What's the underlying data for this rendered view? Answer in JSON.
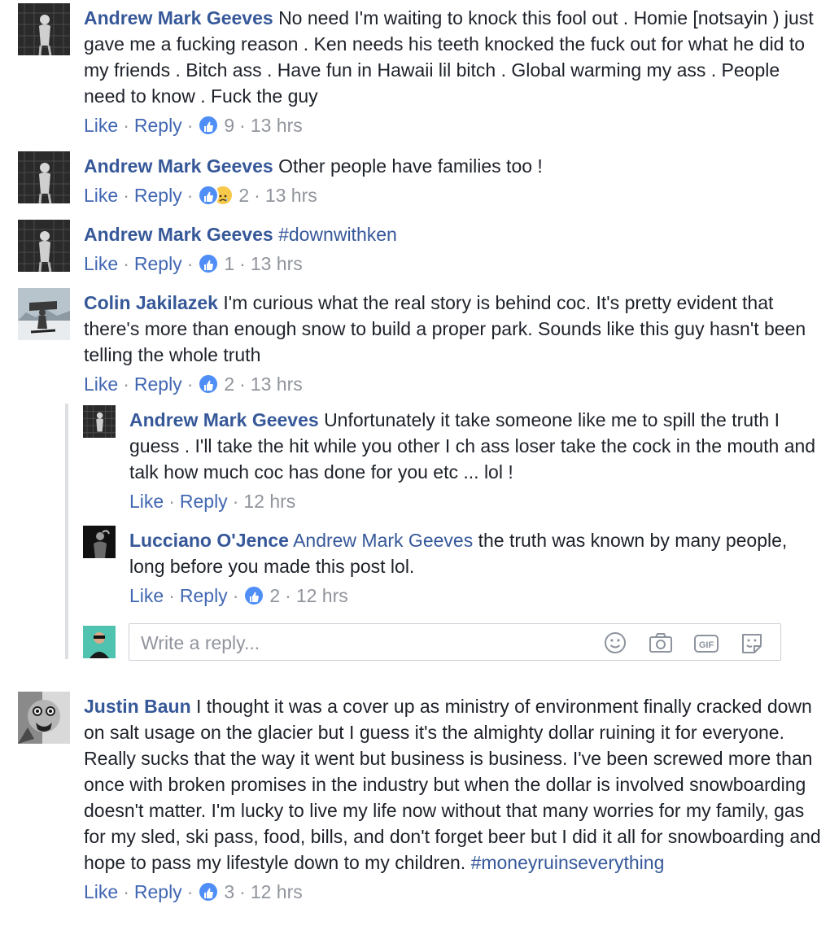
{
  "actions": {
    "like": "Like",
    "reply": "Reply",
    "dot": "·"
  },
  "reply_box": {
    "placeholder": "Write a reply..."
  },
  "comments": [
    {
      "author": "Andrew Mark Geeves",
      "text": "No need I'm waiting to knock this fool out . Homie [notsayin ) just gave me a fucking reason . Ken needs his teeth knocked the fuck out for what he did to my friends . Bitch ass . Have fun in Hawaii lil bitch . Global warming my ass . People need to know . Fuck the guy",
      "reaction_count": "9",
      "time": "13 hrs"
    },
    {
      "author": "Andrew Mark Geeves",
      "text": "Other people have families too !",
      "reaction_count": "2",
      "time": "13 hrs"
    },
    {
      "author": "Andrew Mark Geeves",
      "hashtag": "#downwithken",
      "reaction_count": "1",
      "time": "13 hrs"
    },
    {
      "author": "Colin Jakilazek",
      "text": "I'm curious what the real story is behind coc. It's pretty evident that there's more than enough snow to build a proper park. Sounds like this guy hasn't been telling the whole truth",
      "reaction_count": "2",
      "time": "13 hrs"
    },
    {
      "author": "Andrew Mark Geeves",
      "text": "Unfortunately it take someone like me to spill the truth I guess . I'll take the hit while you other I ch ass loser take the cock in the mouth and talk how much coc has done for you etc ... lol !",
      "time": "12 hrs"
    },
    {
      "author": "Lucciano O'Jence",
      "mention": "Andrew Mark Geeves",
      "text": "the truth was known by many people, long before you made this post lol.",
      "reaction_count": "2",
      "time": "12 hrs"
    },
    {
      "author": "Justin Baun",
      "text": "I thought it was a cover up as ministry of environment finally cracked down on salt usage on the glacier but I guess it's the almighty dollar ruining it for everyone. Really sucks that the way it went but business is business. I've been screwed more than once with broken promises in the industry but when the dollar is involved snowboarding doesn't matter. I'm lucky to live my life now without that many worries for my family, gas for my sled, ski pass, food, bills, and don't forget beer but I did it all for snowboarding and hope to pass my lifestyle down to my children.",
      "hashtag": "#moneyruinseverything",
      "reaction_count": "3",
      "time": "12 hrs"
    }
  ],
  "colors": {
    "link": "#365899",
    "action_link": "#4267b2",
    "meta": "#90949c",
    "like_reaction": "#4f8ef7",
    "sad_reaction": "#f7c84a"
  },
  "icons": {
    "reply_box": [
      "emoji-icon",
      "camera-icon",
      "gif-icon",
      "sticker-icon"
    ]
  }
}
